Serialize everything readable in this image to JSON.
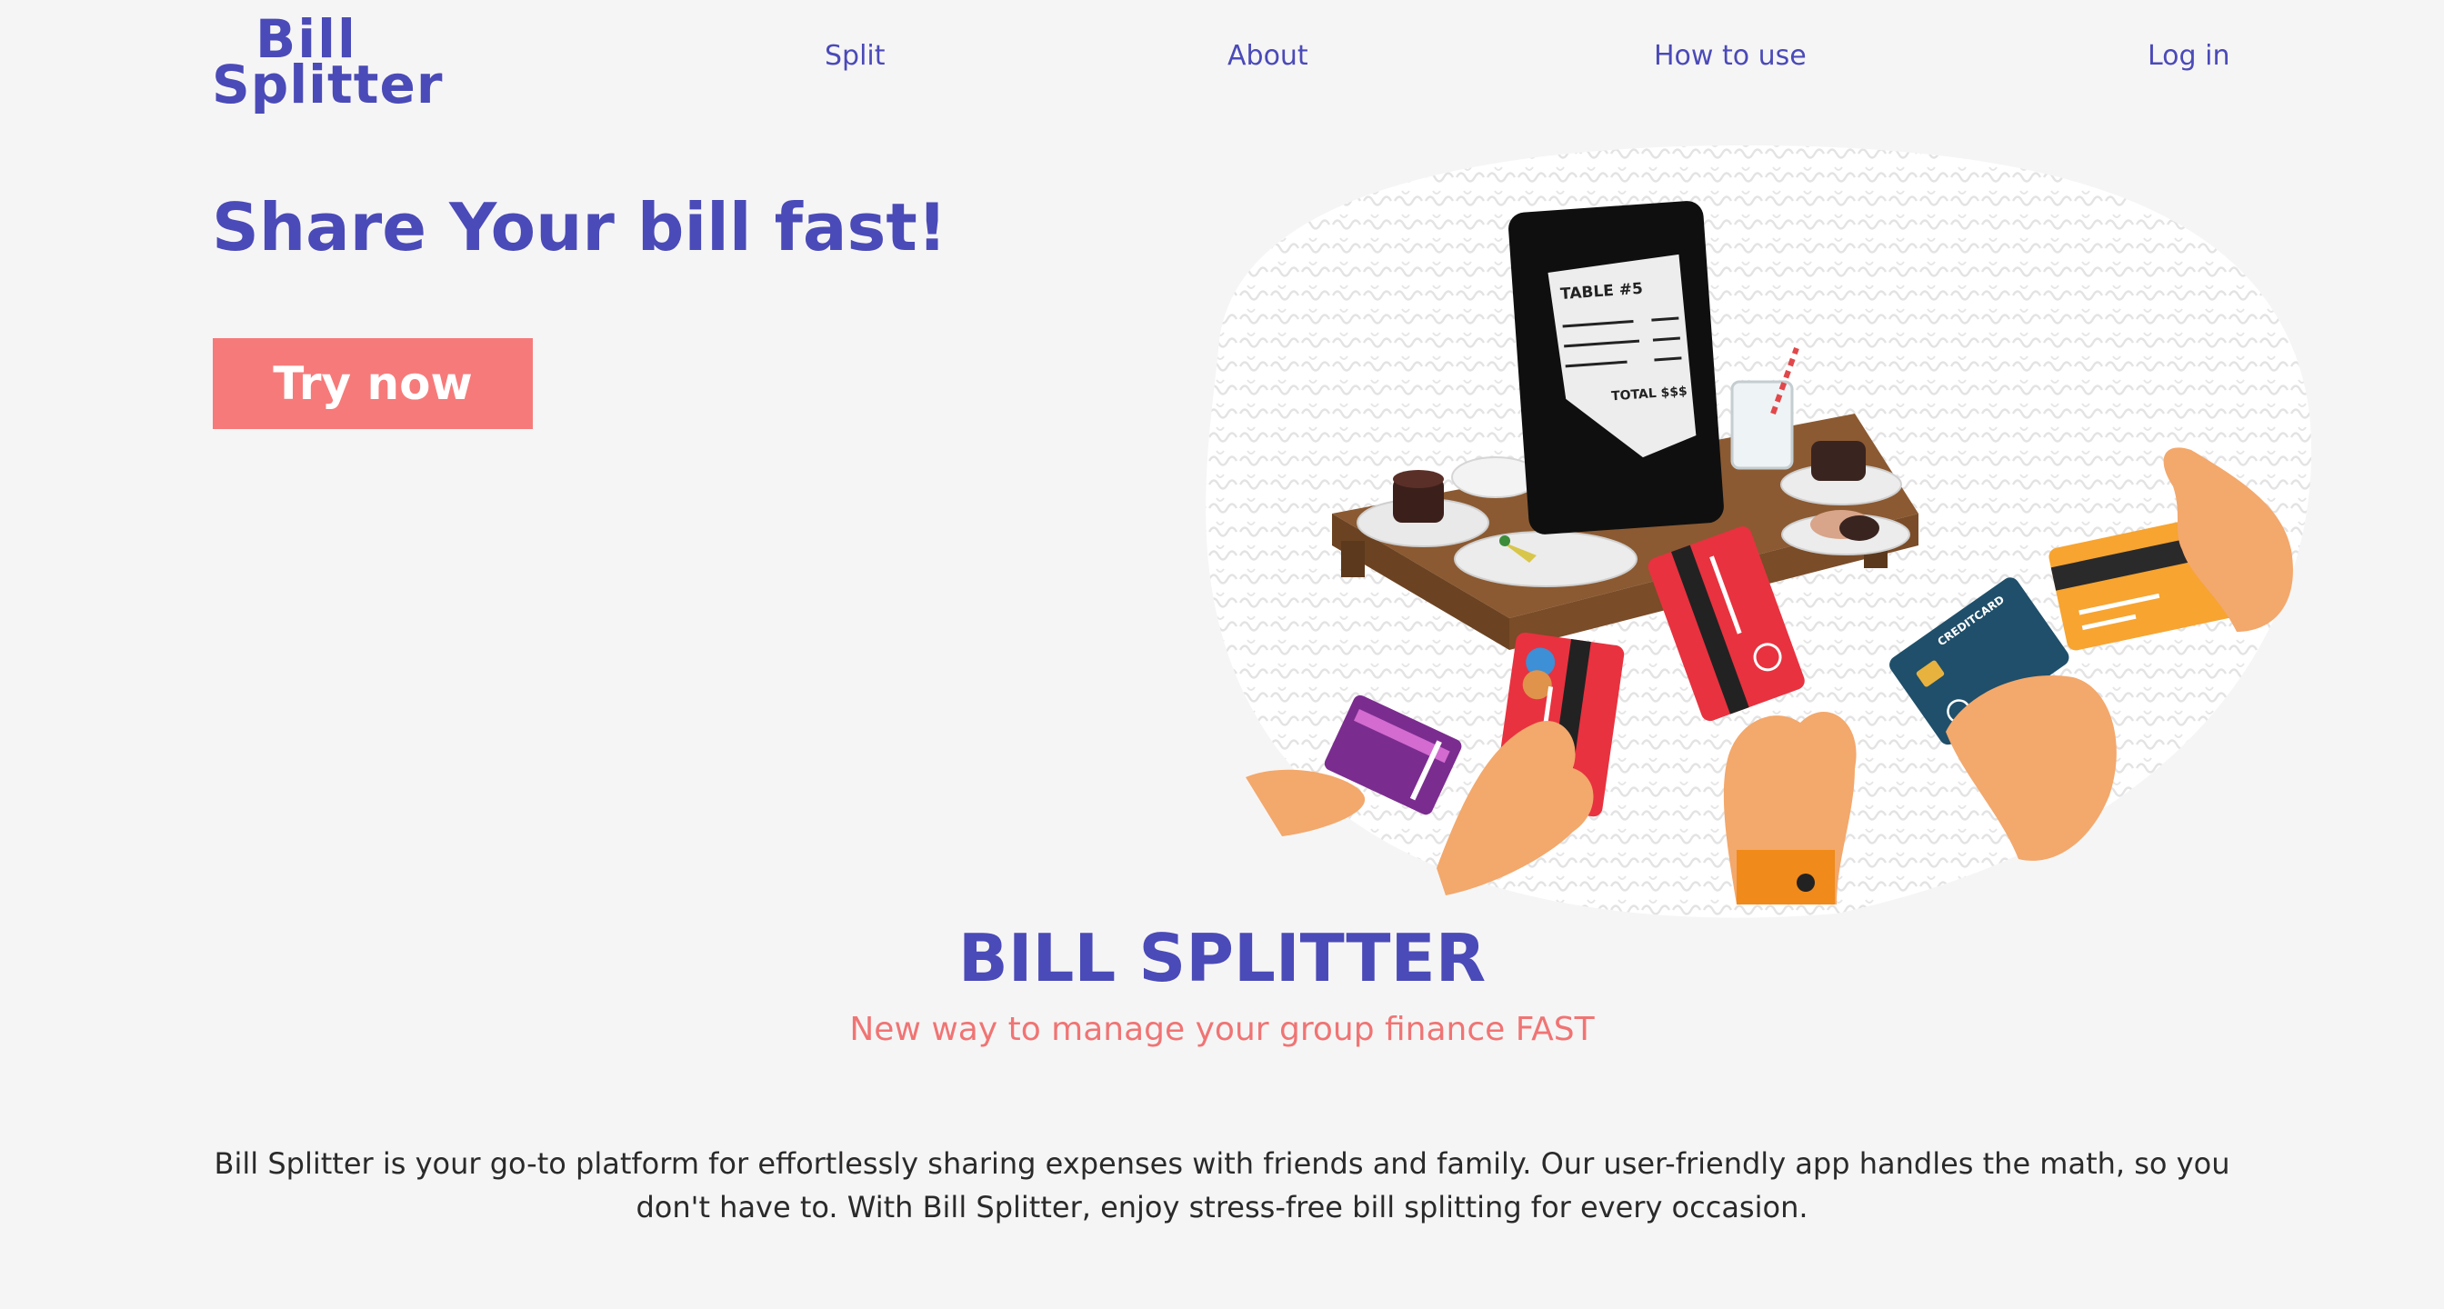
{
  "header": {
    "logo_line1": "Bill",
    "logo_line2": "Splitter",
    "nav": {
      "split": "Split",
      "about": "About",
      "how_to_use": "How to use",
      "login": "Log in"
    }
  },
  "hero": {
    "title": "Share Your bill fast!",
    "cta_label": "Try now",
    "illustration": {
      "receipt_table": "TABLE #5",
      "receipt_total": "TOTAL $$$",
      "card_label": "CREDITCARD"
    }
  },
  "intro": {
    "title": "BILL SPLITTER",
    "subtitle": "New way to manage your group finance FAST",
    "description": "Bill Splitter is your go-to platform for effortlessly sharing expenses with friends and family. Our user-friendly app handles the math, so you don't have to. With Bill Splitter, enjoy stress-free bill splitting for every occasion."
  },
  "colors": {
    "primary": "#4a4ab8",
    "accent": "#f67a7a",
    "background": "#f6f5f5",
    "text": "#2a2a2a"
  }
}
